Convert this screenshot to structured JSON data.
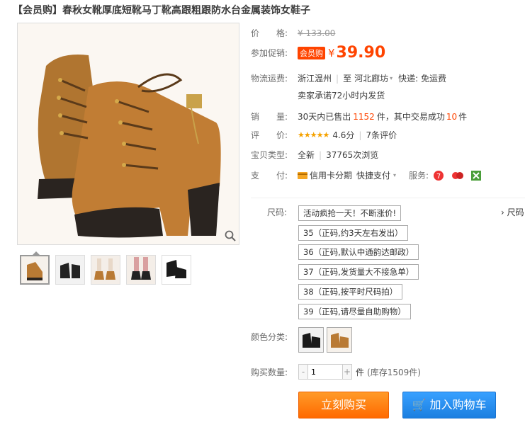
{
  "title": "【会员购】春秋女靴厚底短靴马丁靴高跟粗跟防水台金属装饰女鞋子",
  "price": {
    "label": "价　　格:",
    "original": "¥ 133.00"
  },
  "promo": {
    "label": "参加促销:",
    "tag": "会员购",
    "currency": "¥",
    "value": "39.90"
  },
  "shipping": {
    "label": "物流运费:",
    "from": "浙江温州",
    "divider": "至",
    "to": "河北廊坊",
    "fee": "快递: 免运费",
    "promise": "卖家承诺72小时内发货"
  },
  "sales": {
    "label": "销　　量:",
    "prefix": "30天内已售出",
    "sold": "1152",
    "mid": "件，其中交易成功",
    "success": "10",
    "suffix": "件"
  },
  "rating": {
    "label": "评　　价:",
    "stars": "★★★★★",
    "score": "4.6分",
    "reviews": "7条评价"
  },
  "type": {
    "label": "宝贝类型:",
    "value": "全新",
    "views": "37765次浏览"
  },
  "payment": {
    "label": "支　　付:",
    "credit": "信用卡分期",
    "quick": "快捷支付",
    "service_label": "服务:"
  },
  "size": {
    "label": "尺码:",
    "side_label": "尺码",
    "options": [
      "活动疯抢一天！不断涨价!",
      "35（正码,约3天左右发出）",
      "36（正码,默认中通韵达邮政）",
      "37（正码,发货量大不接急单）",
      "38（正码,按平时尺码拍）",
      "39（正码,请尽量自助购物）"
    ]
  },
  "color": {
    "label": "颜色分类:"
  },
  "quantity": {
    "label": "购买数量:",
    "minus": "-",
    "value": "1",
    "plus": "+",
    "unit": "件",
    "stock": "(库存1509件)"
  },
  "buttons": {
    "buy": "立刻购买",
    "cart": "加入购物车"
  }
}
